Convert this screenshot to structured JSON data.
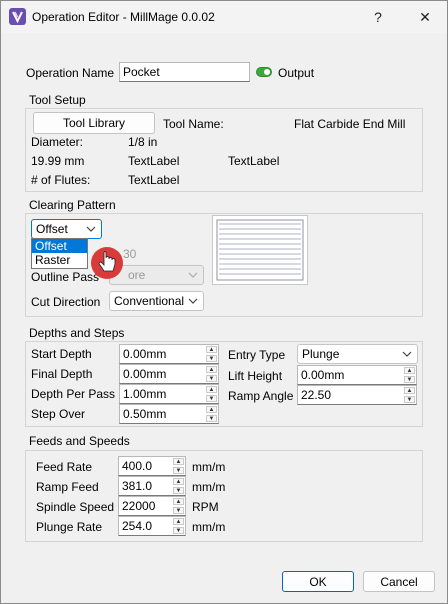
{
  "window": {
    "title": "Operation Editor - MillMage 0.0.02",
    "help_label": "?",
    "close_label": "✕"
  },
  "operation": {
    "name_label": "Operation Name",
    "name_value": "Pocket",
    "output_label": "Output"
  },
  "tool_setup": {
    "title": "Tool Setup",
    "tool_library_label": "Tool Library",
    "tool_name_label": "Tool Name:",
    "tool_name_value": "Flat Carbide End Mill",
    "diameter_label": "Diameter:",
    "diameter_value": "1/8 in",
    "diameter_mm": "19.99 mm",
    "textlabel_1": "TextLabel",
    "textlabel_2": "TextLabel",
    "flutes_label": "# of Flutes:",
    "flutes_value": "TextLabel"
  },
  "clearing": {
    "title": "Clearing Pattern",
    "pattern_selected": "Offset",
    "pattern_options": [
      "Offset",
      "Raster"
    ],
    "hidden_value": "30",
    "outline_pass_label": "Outline Pass",
    "outline_pass_value": "ore",
    "cut_direction_label": "Cut Direction",
    "cut_direction_value": "Conventional"
  },
  "depths": {
    "title": "Depths and Steps",
    "start_depth_label": "Start Depth",
    "start_depth_value": "0.00mm",
    "final_depth_label": "Final Depth",
    "final_depth_value": "0.00mm",
    "depth_per_pass_label": "Depth Per Pass",
    "depth_per_pass_value": "1.00mm",
    "step_over_label": "Step Over",
    "step_over_value": "0.50mm",
    "entry_type_label": "Entry Type",
    "entry_type_value": "Plunge",
    "lift_height_label": "Lift Height",
    "lift_height_value": "0.00mm",
    "ramp_angle_label": "Ramp Angle",
    "ramp_angle_value": "22.50"
  },
  "feeds": {
    "title": "Feeds and Speeds",
    "feed_rate_label": "Feed Rate",
    "feed_rate_value": "400.0",
    "feed_rate_unit": "mm/m",
    "ramp_feed_label": "Ramp Feed",
    "ramp_feed_value": "381.0",
    "ramp_feed_unit": "mm/m",
    "spindle_speed_label": "Spindle Speed",
    "spindle_speed_value": "22000",
    "spindle_speed_unit": "RPM",
    "plunge_rate_label": "Plunge Rate",
    "plunge_rate_value": "254.0",
    "plunge_rate_unit": "mm/m"
  },
  "footer": {
    "ok_label": "OK",
    "cancel_label": "Cancel"
  },
  "colors": {
    "accent": "#0078d7",
    "toggle_on": "#3fa63f",
    "cursor_red": "#d93b3b"
  }
}
